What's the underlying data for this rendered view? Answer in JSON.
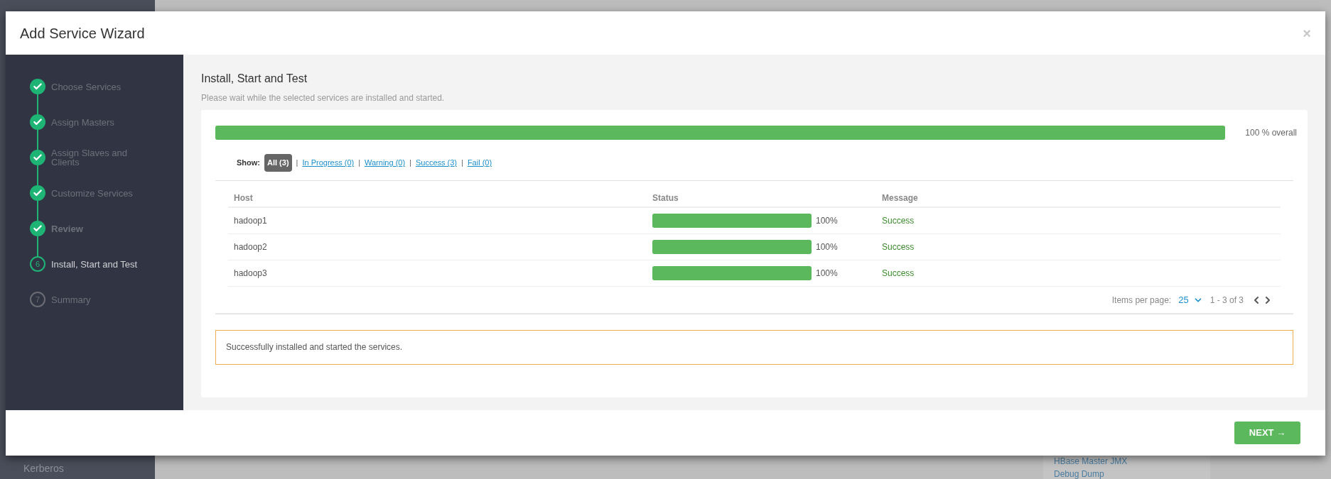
{
  "background": {
    "sidebar_items": [
      "Kerberos"
    ],
    "links": [
      "HBase Master JMX",
      "Debug Dump"
    ]
  },
  "dialog": {
    "title": "Add Service Wizard",
    "close": "×",
    "steps": [
      {
        "label": "Choose Services",
        "completed": true,
        "current": false,
        "emphasized": false
      },
      {
        "label": "Assign Masters",
        "completed": true,
        "current": false,
        "emphasized": false
      },
      {
        "label": "Assign Slaves and Clients",
        "completed": true,
        "current": false,
        "emphasized": false
      },
      {
        "label": "Customize Services",
        "completed": true,
        "current": false,
        "emphasized": false
      },
      {
        "label": "Review",
        "completed": true,
        "current": false,
        "emphasized": true
      },
      {
        "number": "6",
        "label": "Install, Start and Test",
        "completed": false,
        "current": true,
        "emphasized": false
      },
      {
        "number": "7",
        "label": "Summary",
        "completed": false,
        "current": false,
        "emphasized": false
      }
    ],
    "heading": "Install, Start and Test",
    "subtitle": "Please wait while the selected services are installed and started.",
    "overall": {
      "level": 1,
      "reading": "100 % overall"
    },
    "filter_label": "Show:",
    "filters": [
      {
        "label": "All (3)",
        "selected": true
      },
      {
        "separator": "|",
        "label": "In Progress (0)",
        "selected": false
      },
      {
        "separator": "|",
        "label": "Warning (0)",
        "selected": false
      },
      {
        "separator": "|",
        "label": "Success (3)",
        "selected": false
      },
      {
        "separator": "|",
        "label": "Fail (0)",
        "selected": false
      }
    ],
    "table": {
      "columns": [
        "Host",
        "Status",
        "Message"
      ],
      "rows": [
        {
          "host": "hadoop1",
          "level": 1,
          "reading": "100%",
          "message": "Success"
        },
        {
          "host": "hadoop2",
          "level": 1,
          "reading": "100%",
          "message": "Success"
        },
        {
          "host": "hadoop3",
          "level": 1,
          "reading": "100%",
          "message": "Success"
        }
      ]
    },
    "pagination": {
      "label": "Items per page:",
      "page_size": "25",
      "range": "1 - 3 of 3"
    },
    "alert": "Successfully installed and started the services.",
    "next_button": "NEXT →"
  }
}
